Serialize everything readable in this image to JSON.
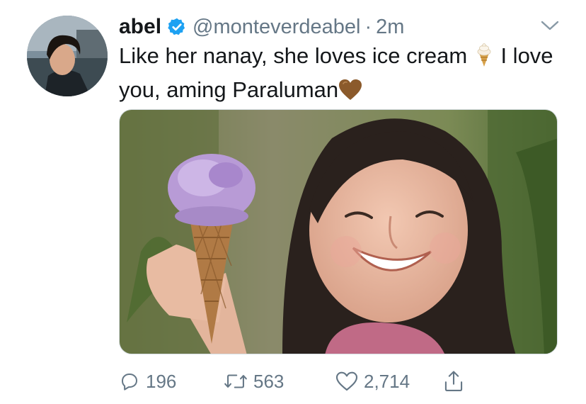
{
  "tweet": {
    "author_name": "abel",
    "handle": "@monteverdeabel",
    "separator": "·",
    "time": "2m",
    "text_part1": "Like her nanay, she loves ice cream ",
    "text_part2": " I love you, aming Paraluman",
    "emoji_1": "soft-ice-cream-icon",
    "emoji_2": "brown-heart-icon"
  },
  "stats": {
    "replies": "196",
    "retweets": "563",
    "likes": "2,714"
  },
  "colors": {
    "verified_badge": "#1da1f2",
    "secondary_text": "#657786",
    "primary_text": "#14171a",
    "heart_emoji": "#8b5a2b"
  }
}
